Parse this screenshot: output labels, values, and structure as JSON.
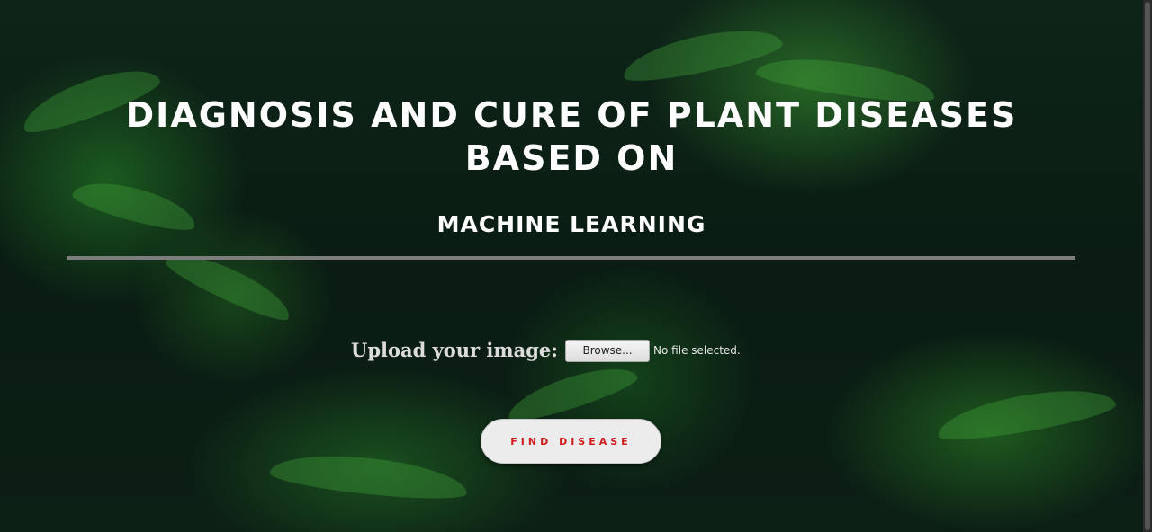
{
  "page": {
    "title_line1": "DIAGNOSIS AND CURE OF PLANT DISEASES",
    "title_line2": "BASED ON",
    "subtitle": "MACHINE LEARNING"
  },
  "upload": {
    "label": "Upload your image:",
    "browse_label": "Browse...",
    "status": "No file selected."
  },
  "actions": {
    "find_label": "FIND DISEASE"
  },
  "colors": {
    "accent_text": "#d11a1a",
    "background": "#0a1c13",
    "divider": "#7d7d7d"
  }
}
